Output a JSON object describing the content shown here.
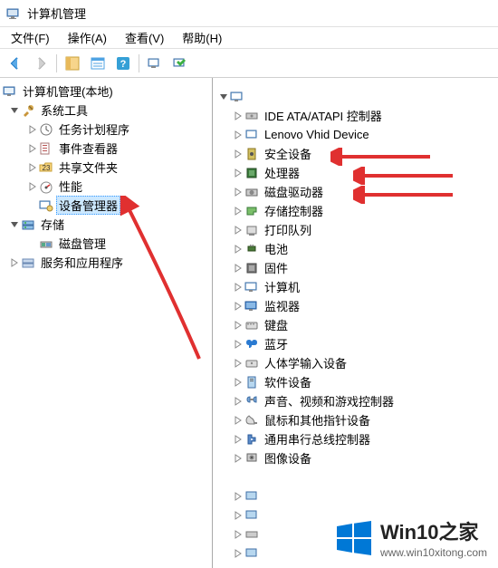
{
  "window": {
    "title": "计算机管理"
  },
  "menubar": [
    {
      "label": "文件(F)"
    },
    {
      "label": "操作(A)"
    },
    {
      "label": "查看(V)"
    },
    {
      "label": "帮助(H)"
    }
  ],
  "left_tree": {
    "root": "计算机管理(本地)",
    "system_tools": "系统工具",
    "task_scheduler": "任务计划程序",
    "event_viewer": "事件查看器",
    "shared_folders": "共享文件夹",
    "performance": "性能",
    "device_manager": "设备管理器",
    "storage": "存储",
    "disk_management": "磁盘管理",
    "services_apps": "服务和应用程序"
  },
  "right_tree": {
    "items": [
      "IDE ATA/ATAPI 控制器",
      "Lenovo Vhid Device",
      "安全设备",
      "处理器",
      "磁盘驱动器",
      "存储控制器",
      "打印队列",
      "电池",
      "固件",
      "计算机",
      "监视器",
      "键盘",
      "蓝牙",
      "人体学输入设备",
      "软件设备",
      "声音、视频和游戏控制器",
      "鼠标和其他指针设备",
      "通用串行总线控制器",
      "图像设备"
    ]
  },
  "watermark": {
    "name": "Win10之家",
    "url": "www.win10xitong.com"
  }
}
